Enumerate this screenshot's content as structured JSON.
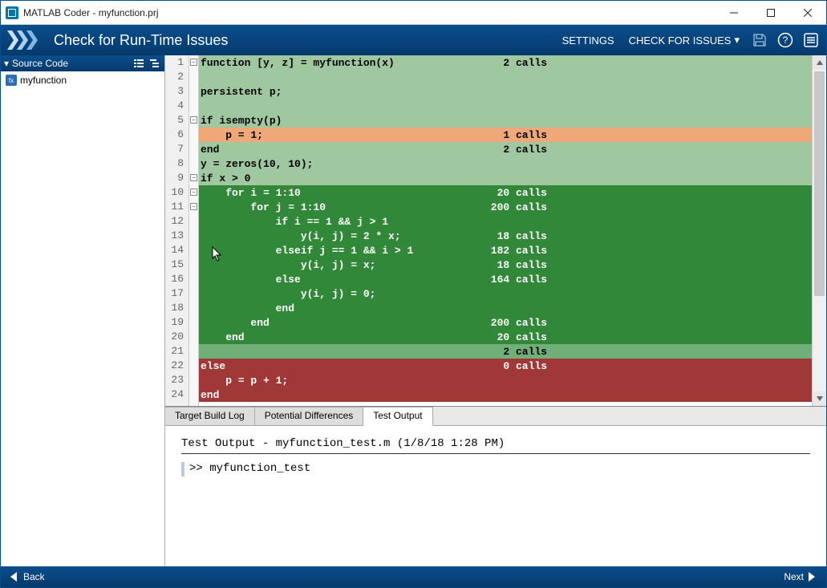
{
  "titlebar": {
    "title": "MATLAB Coder - myfunction.prj"
  },
  "toolbar": {
    "step_title": "Check for Run-Time Issues",
    "settings": "SETTINGS",
    "check": "CHECK FOR ISSUES"
  },
  "sidebar": {
    "header": "Source Code",
    "items": [
      {
        "label": "myfunction"
      }
    ]
  },
  "code": {
    "lines": [
      {
        "n": 1,
        "cls": "cov-lightgreen",
        "text": "function [y, z] = myfunction(x)",
        "calls": "2 calls",
        "fold": true
      },
      {
        "n": 2,
        "cls": "cov-lightgreen",
        "text": ""
      },
      {
        "n": 3,
        "cls": "cov-lightgreen",
        "text": "persistent p;"
      },
      {
        "n": 4,
        "cls": "cov-lightgreen",
        "text": ""
      },
      {
        "n": 5,
        "cls": "cov-lightgreen",
        "text": "if isempty(p)",
        "fold": true
      },
      {
        "n": 6,
        "cls": "cov-orange",
        "text": "    p = 1;",
        "calls": "1 calls"
      },
      {
        "n": 7,
        "cls": "cov-lightgreen",
        "text": "end",
        "calls": "2 calls"
      },
      {
        "n": 8,
        "cls": "cov-lightgreen",
        "text": "y = zeros(10, 10);"
      },
      {
        "n": 9,
        "cls": "cov-lightgreen",
        "text": "if x > 0",
        "fold": true
      },
      {
        "n": 10,
        "cls": "cov-green",
        "text": "    for i = 1:10",
        "calls": "20 calls",
        "fold": true
      },
      {
        "n": 11,
        "cls": "cov-green",
        "text": "        for j = 1:10",
        "calls": "200 calls",
        "fold": true
      },
      {
        "n": 12,
        "cls": "cov-green",
        "text": "            if i == 1 && j > 1"
      },
      {
        "n": 13,
        "cls": "cov-green",
        "text": "                y(i, j) = 2 * x;",
        "calls": "18 calls"
      },
      {
        "n": 14,
        "cls": "cov-green",
        "text": "            elseif j == 1 && i > 1",
        "calls": "182 calls"
      },
      {
        "n": 15,
        "cls": "cov-green",
        "text": "                y(i, j) = x;",
        "calls": "18 calls"
      },
      {
        "n": 16,
        "cls": "cov-green",
        "text": "            else",
        "calls": "164 calls"
      },
      {
        "n": 17,
        "cls": "cov-green",
        "text": "                y(i, j) = 0;"
      },
      {
        "n": 18,
        "cls": "cov-green",
        "text": "            end"
      },
      {
        "n": 19,
        "cls": "cov-green",
        "text": "        end",
        "calls": "200 calls"
      },
      {
        "n": 20,
        "cls": "cov-green",
        "text": "    end",
        "calls": "20 calls"
      },
      {
        "n": 21,
        "cls": "cov-midgreen",
        "text": "",
        "calls": "2 calls"
      },
      {
        "n": 22,
        "cls": "cov-red",
        "text": "else",
        "calls": "0 calls"
      },
      {
        "n": 23,
        "cls": "cov-red",
        "text": "    p = p + 1;"
      },
      {
        "n": 24,
        "cls": "cov-red",
        "text": "end"
      }
    ]
  },
  "tabs": [
    {
      "label": "Target Build Log",
      "active": false
    },
    {
      "label": "Potential Differences",
      "active": false
    },
    {
      "label": "Test Output",
      "active": true
    }
  ],
  "test_output": {
    "header": "Test Output - myfunction_test.m   (1/8/18 1:28 PM)",
    "command": ">> myfunction_test"
  },
  "footer": {
    "back": "Back",
    "next": "Next"
  }
}
